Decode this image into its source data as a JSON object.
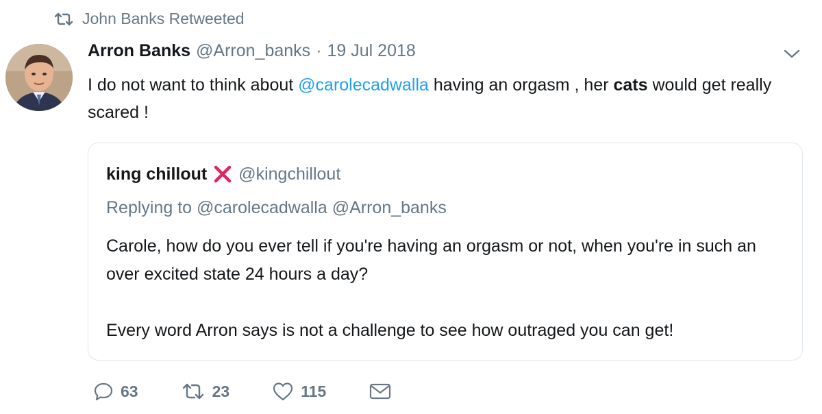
{
  "retweet_header": {
    "icon": "retweet-icon",
    "text": "John Banks Retweeted"
  },
  "tweet": {
    "author_name": "Arron Banks",
    "author_handle": "@Arron_banks",
    "separator": "·",
    "date": "19 Jul 2018",
    "text_parts": {
      "p1": "I do not want to think about ",
      "mention": "@carolecadwalla",
      "p2": " having an orgasm , her ",
      "bold": "cats",
      "p3": " would get really scared !"
    }
  },
  "quoted_tweet": {
    "author_name": "king chillout",
    "badge_icon": "red-cross-icon",
    "author_handle": "@kingchillout",
    "replying_to": "Replying to @carolecadwalla @Arron_banks",
    "paragraph1": "Carole, how do you ever tell if you're having an orgasm or not, when you're in such an over excited state 24 hours a day?",
    "paragraph2": "Every word Arron says is not a challenge to see how outraged you can get!"
  },
  "actions": {
    "replies": "63",
    "retweets": "23",
    "likes": "115"
  },
  "colors": {
    "mention": "#1da1f2",
    "muted": "#657786",
    "cross": "#e0245e",
    "border": "#e1e8ed"
  }
}
